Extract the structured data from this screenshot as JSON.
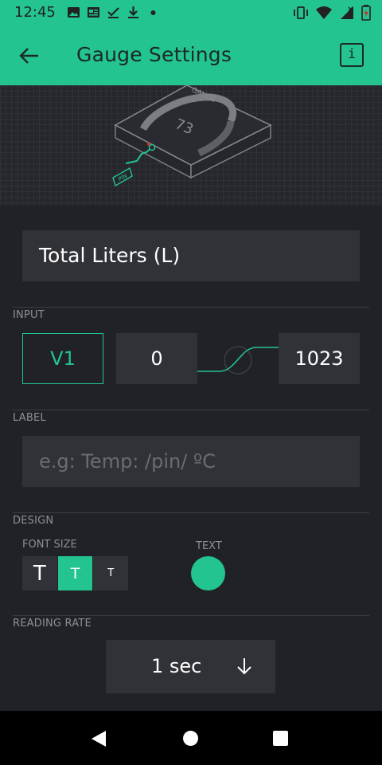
{
  "status_bar": {
    "time": "12:45"
  },
  "app_bar": {
    "title": "Gauge Settings",
    "info_label": "i"
  },
  "preview": {
    "gauge_value": "73",
    "gauge_word": "GAUGE",
    "pin_word": "PIN"
  },
  "form": {
    "name_value": "Total Liters (L)",
    "input_section": "INPUT",
    "pin": "V1",
    "min": "0",
    "max": "1023",
    "label_section": "LABEL",
    "label_placeholder": "e.g: Temp: /pin/ ºC",
    "design_section": "DESIGN",
    "font_size_label": "FONT SIZE",
    "font_sizes": [
      "T",
      "T",
      "T"
    ],
    "text_label": "TEXT",
    "text_color": "#23c490",
    "reading_rate_section": "READING RATE",
    "reading_rate": "1 sec"
  },
  "colors": {
    "accent": "#23c490",
    "background": "#212227",
    "field": "#313238"
  }
}
